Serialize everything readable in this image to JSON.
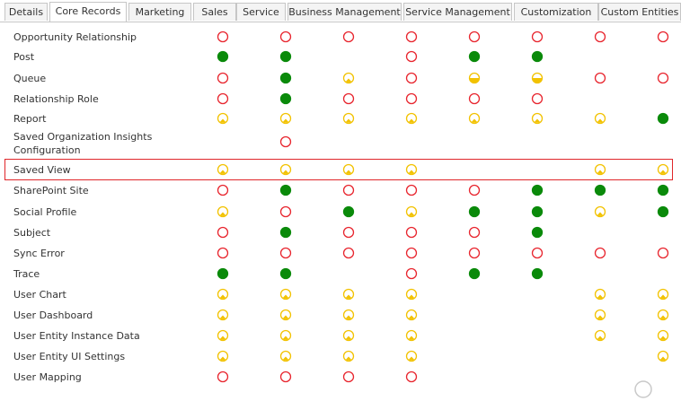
{
  "tabs": [
    {
      "label": "Details",
      "active": false
    },
    {
      "label": "Core Records",
      "active": true
    },
    {
      "label": "Marketing",
      "active": false
    },
    {
      "label": "Sales",
      "active": false
    },
    {
      "label": "Service",
      "active": false
    },
    {
      "label": "Business Management",
      "active": false
    },
    {
      "label": "Service Management",
      "active": false
    },
    {
      "label": "Customization",
      "active": false
    },
    {
      "label": "Custom Entities",
      "active": false
    }
  ],
  "legend_icons": {
    "none": "circle-outline-red-icon",
    "user": "circle-quarter-yellow-icon",
    "bu": "circle-half-yellow-icon",
    "org": "circle-full-green-icon"
  },
  "colors": {
    "none": "#e8252e",
    "partial": "#f2c200",
    "full": "#0a8a0a",
    "highlight": "#e0262a"
  },
  "privilege_rows": [
    {
      "label": "Opportunity Relationship",
      "cells": [
        "none",
        "none",
        "none",
        "none",
        "none",
        "none",
        "none",
        "none"
      ]
    },
    {
      "label": "Post",
      "cells": [
        "org",
        "org",
        "",
        "none",
        "org",
        "org",
        "",
        ""
      ]
    },
    {
      "label": "Queue",
      "cells": [
        "none",
        "org",
        "user",
        "none",
        "bu",
        "bu",
        "none",
        "none"
      ]
    },
    {
      "label": "Relationship Role",
      "cells": [
        "none",
        "org",
        "none",
        "none",
        "none",
        "none",
        "",
        ""
      ]
    },
    {
      "label": "Report",
      "cells": [
        "user",
        "user",
        "user",
        "user",
        "user",
        "user",
        "user",
        "org"
      ]
    },
    {
      "label": "Saved Organization Insights Configuration",
      "cells": [
        "",
        "none",
        "",
        "",
        "",
        "",
        "",
        ""
      ]
    },
    {
      "label": "Saved View",
      "cells": [
        "user",
        "user",
        "user",
        "user",
        "",
        "",
        "user",
        "user"
      ],
      "highlighted": true
    },
    {
      "label": "SharePoint Site",
      "cells": [
        "none",
        "org",
        "none",
        "none",
        "none",
        "org",
        "org",
        "org"
      ]
    },
    {
      "label": "Social Profile",
      "cells": [
        "user",
        "none",
        "org",
        "user",
        "org",
        "org",
        "user",
        "org"
      ]
    },
    {
      "label": "Subject",
      "cells": [
        "none",
        "org",
        "none",
        "none",
        "none",
        "org",
        "",
        ""
      ]
    },
    {
      "label": "Sync Error",
      "cells": [
        "none",
        "none",
        "none",
        "none",
        "none",
        "none",
        "none",
        "none"
      ]
    },
    {
      "label": "Trace",
      "cells": [
        "org",
        "org",
        "",
        "none",
        "org",
        "org",
        "",
        ""
      ]
    },
    {
      "label": "User Chart",
      "cells": [
        "user",
        "user",
        "user",
        "user",
        "",
        "",
        "user",
        "user"
      ]
    },
    {
      "label": "User Dashboard",
      "cells": [
        "user",
        "user",
        "user",
        "user",
        "",
        "",
        "user",
        "user"
      ]
    },
    {
      "label": "User Entity Instance Data",
      "cells": [
        "user",
        "user",
        "user",
        "user",
        "",
        "",
        "user",
        "user"
      ]
    },
    {
      "label": "User Entity UI Settings",
      "cells": [
        "user",
        "user",
        "user",
        "user",
        "",
        "",
        "",
        "user"
      ]
    },
    {
      "label": "User Mapping",
      "cells": [
        "none",
        "none",
        "none",
        "none",
        "",
        "",
        "",
        ""
      ]
    }
  ]
}
